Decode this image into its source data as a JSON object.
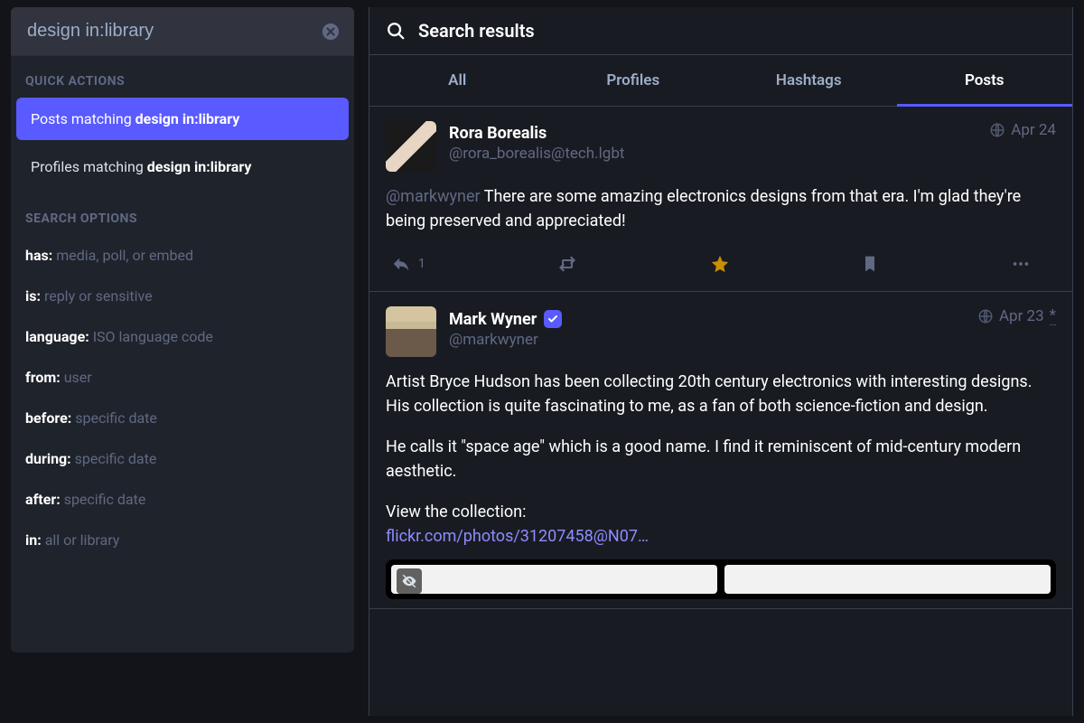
{
  "search": {
    "value": "design in:library"
  },
  "quick_actions_label": "QUICK ACTIONS",
  "quick_actions": [
    {
      "prefix": "Posts matching ",
      "query": "design in:library",
      "active": true
    },
    {
      "prefix": "Profiles matching ",
      "query": "design in:library",
      "active": false
    }
  ],
  "search_options_label": "SEARCH OPTIONS",
  "search_options": [
    {
      "key": "has:",
      "hint": " media, poll, or embed"
    },
    {
      "key": "is:",
      "hint": " reply or sensitive"
    },
    {
      "key": "language:",
      "hint": " ISO language code"
    },
    {
      "key": "from:",
      "hint": " user"
    },
    {
      "key": "before:",
      "hint": " specific date"
    },
    {
      "key": "during:",
      "hint": " specific date"
    },
    {
      "key": "after:",
      "hint": " specific date"
    },
    {
      "key": "in:",
      "hint": " all or library"
    }
  ],
  "header": {
    "title": "Search results"
  },
  "tabs": [
    "All",
    "Profiles",
    "Hashtags",
    "Posts"
  ],
  "active_tab": 3,
  "posts": [
    {
      "display_name": "Rora Borealis",
      "handle": "@rora_borealis@tech.lgbt",
      "date": "Apr 24",
      "verified": false,
      "body_mention": "@markwyner",
      "body_text": " There are some amazing electronics designs from that era. I'm glad they're being preserved and appreciated!",
      "reply_count": "1",
      "favorited": true
    },
    {
      "display_name": "Mark Wyner",
      "handle": "@markwyner",
      "date": "Apr 23 ",
      "edited_marker": "*",
      "verified": true,
      "paragraphs": [
        "Artist Bryce Hudson has been collecting 20th century electronics with interesting designs. His collection is quite fascinating to me, as a fan of both science-fiction and design.",
        "He calls it \"space age\" which is a good name. I find it reminiscent of mid-century modern aesthetic."
      ],
      "link_intro": "View the collection:",
      "link_text": "flickr.com/photos/31207458@N07…"
    }
  ]
}
